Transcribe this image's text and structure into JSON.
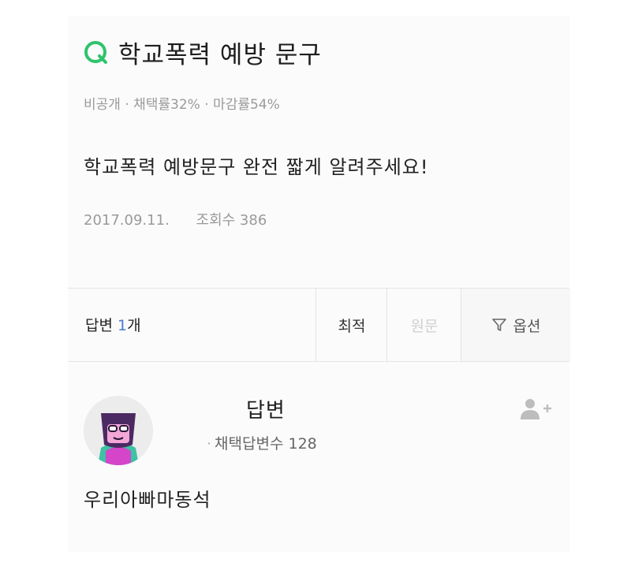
{
  "question": {
    "title": "학교폭력 예방 문구",
    "meta": "비공개 · 채택률32% · 마감률54%",
    "body": "학교폭력 예방문구 완전 짧게 알려주세요!",
    "date": "2017.09.11.",
    "views": "조회수 386"
  },
  "answers_bar": {
    "label": "답변",
    "count": "1",
    "unit": "개",
    "sort_best": "최적",
    "sort_original": "원문",
    "options": "옵션"
  },
  "answer": {
    "author_label": "답변",
    "stat_dot": "·",
    "stat": "채택답변수 128",
    "body": "우리아빠마동석"
  },
  "colors": {
    "q_icon": "#2ec36b",
    "count_accent": "#4a7bd0",
    "muted_text": "#9a9a9a"
  },
  "icons": {
    "question": "q-icon",
    "filter": "filter-icon",
    "follow": "add-user-icon",
    "avatar": "avatar-illustration"
  }
}
